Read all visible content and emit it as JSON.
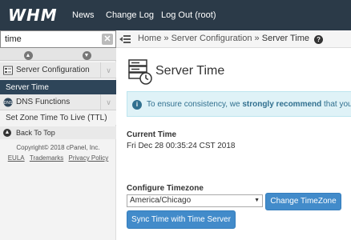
{
  "header": {
    "logo": "WHM",
    "nav": [
      "News",
      "Change Log",
      "Log Out (root)"
    ]
  },
  "sidebar": {
    "search": {
      "value": "time",
      "placeholder": ""
    },
    "clear_icon": "close-icon",
    "groups": [
      {
        "label": "Server Configuration",
        "icon": "server-config-icon"
      },
      {
        "label": "DNS Functions",
        "icon": "dns-icon"
      }
    ],
    "items": [
      {
        "label": "Server Time",
        "active": true
      },
      {
        "label": "Set Zone Time To Live (TTL)",
        "active": false
      }
    ],
    "back_to_top": "Back To Top",
    "copyright": "Copyright© 2018 cPanel, Inc.",
    "footer_links": [
      "EULA",
      "Trademarks",
      "Privacy Policy"
    ]
  },
  "breadcrumb": {
    "home": "Home",
    "section": "Server Configuration",
    "current": "Server Time",
    "sep": "»"
  },
  "main": {
    "title": "Server Time",
    "alert": {
      "prefix": "To ensure consistency, we",
      "strong": "strongly recommend",
      "suffix": "that you r"
    },
    "current_time_label": "Current Time",
    "current_time_value": "Fri Dec 28 00:35:24 CST 2018",
    "timezone_label": "Configure Timezone",
    "timezone_selected": "America/Chicago",
    "change_button": "Change TimeZone",
    "sync_button": "Sync Time with Time Server"
  },
  "colors": {
    "topbar": "#2b3a48",
    "active_item": "#2e4559",
    "primary_button": "#428bca",
    "alert_bg": "#dff2f7",
    "alert_text": "#31708f"
  }
}
